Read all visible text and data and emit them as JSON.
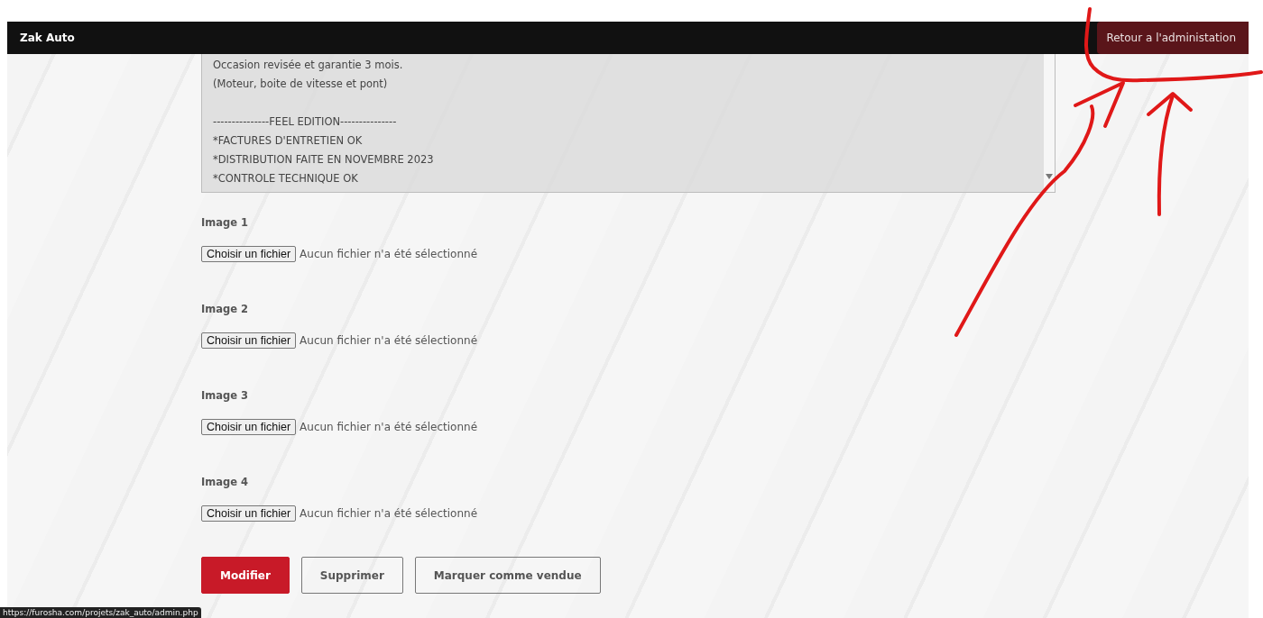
{
  "navbar": {
    "brand": "Zak Auto",
    "admin_link": "Retour a l'administation"
  },
  "description": {
    "paragraphs": [
      [
        "Occasion revisée et garantie 3 mois.",
        "(Moteur, boite de vitesse et pont)"
      ],
      [
        "---------------FEEL EDITION---------------",
        "*FACTURES D'ENTRETIEN OK",
        "*DISTRIBUTION FAITE EN NOVEMBRE 2023",
        "*CONTROLE TECHNIQUE OK"
      ]
    ]
  },
  "images": [
    {
      "label": "Image 1",
      "button": "Choisir un fichier",
      "status": "Aucun fichier n'a été sélectionné"
    },
    {
      "label": "Image 2",
      "button": "Choisir un fichier",
      "status": "Aucun fichier n'a été sélectionné"
    },
    {
      "label": "Image 3",
      "button": "Choisir un fichier",
      "status": "Aucun fichier n'a été sélectionné"
    },
    {
      "label": "Image 4",
      "button": "Choisir un fichier",
      "status": "Aucun fichier n'a été sélectionné"
    }
  ],
  "actions": [
    {
      "label": "Modifier",
      "kind": "primary"
    },
    {
      "label": "Supprimer",
      "kind": "secondary"
    },
    {
      "label": "Marquer comme vendue",
      "kind": "secondary"
    }
  ],
  "status_url": "https://furosha.com/projets/zak_auto/admin.php"
}
